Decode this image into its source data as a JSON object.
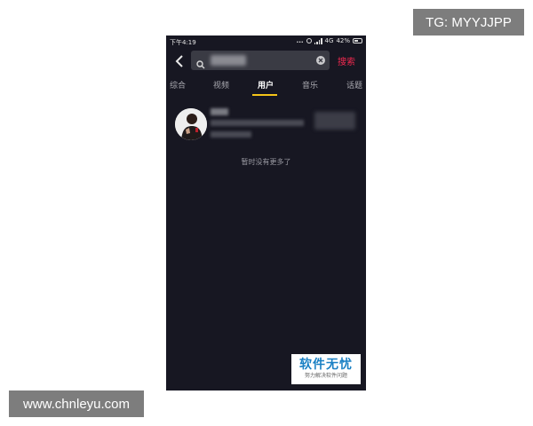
{
  "overlay": {
    "tg_label": "TG: MYYJJPP",
    "site_label": "www.chnleyu.com"
  },
  "statusbar": {
    "time": "下午4:19",
    "dots": "...",
    "network": "4G",
    "battery": "42%"
  },
  "search": {
    "query": "",
    "button_label": "搜索"
  },
  "tabs": [
    {
      "label": "综合",
      "active": false
    },
    {
      "label": "视频",
      "active": false
    },
    {
      "label": "用户",
      "active": true
    },
    {
      "label": "音乐",
      "active": false
    },
    {
      "label": "话题",
      "active": false
    }
  ],
  "result": {
    "user_name": "",
    "user_id": "",
    "user_fans": "",
    "follow_label": ""
  },
  "empty_message": "暂时没有更多了",
  "watermark": {
    "title": "软件无忧",
    "subtitle": "努力解决软件问题"
  },
  "colors": {
    "background": "#171722",
    "accent": "#f0294f",
    "tab_indicator": "#f5c518"
  }
}
